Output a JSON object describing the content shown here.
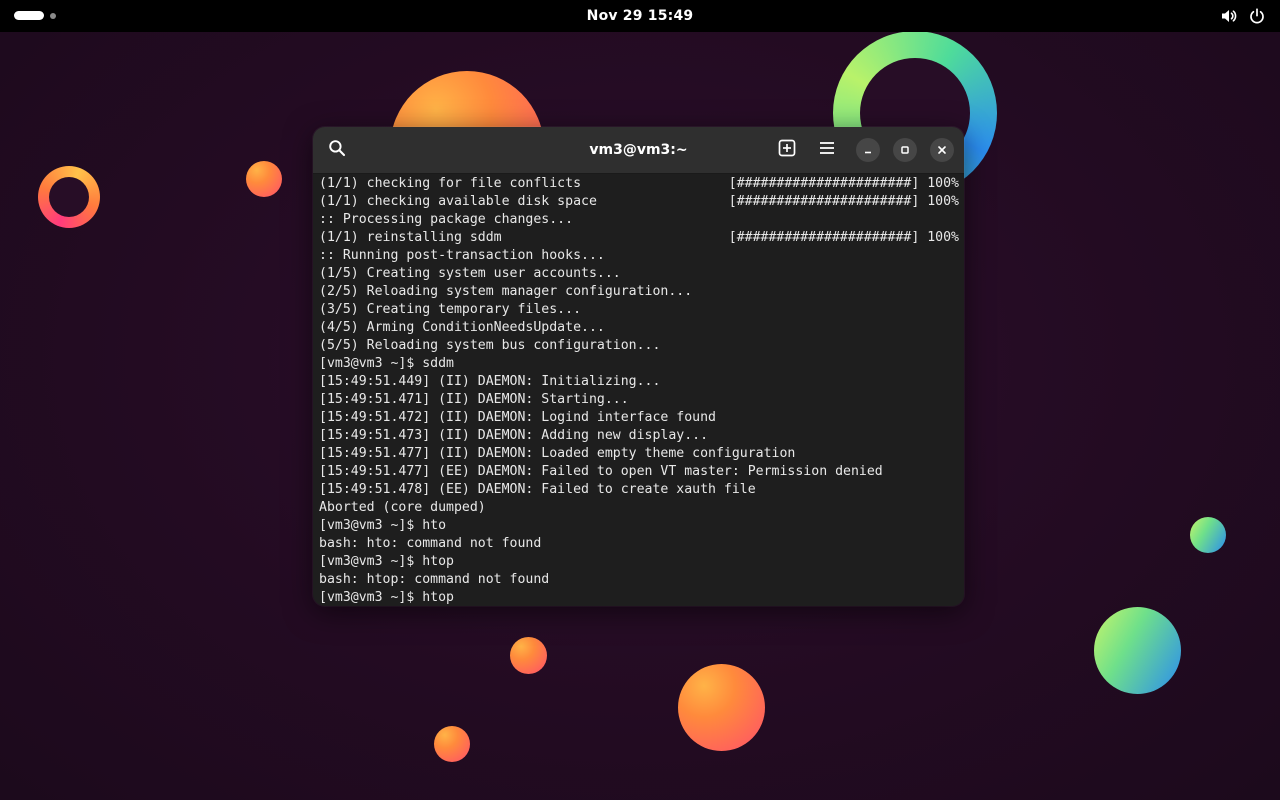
{
  "topbar": {
    "clock": "Nov 29  15:49",
    "icons": [
      "volume-icon",
      "power-icon"
    ]
  },
  "window": {
    "title": "vm3@vm3:~",
    "icons": [
      "search-icon",
      "new-tab-icon",
      "hamburger-menu-icon",
      "minimize-icon",
      "maximize-icon",
      "close-icon"
    ]
  },
  "terminal": {
    "lines": [
      {
        "text": "(1/1) checking for file conflicts",
        "progress": "[######################] 100%"
      },
      {
        "text": "(1/1) checking available disk space",
        "progress": "[######################] 100%"
      },
      {
        "text": ":: Processing package changes...",
        "progress": ""
      },
      {
        "text": "(1/1) reinstalling sddm",
        "progress": "[######################] 100%"
      },
      {
        "text": ":: Running post-transaction hooks...",
        "progress": ""
      },
      {
        "text": "(1/5) Creating system user accounts...",
        "progress": ""
      },
      {
        "text": "(2/5) Reloading system manager configuration...",
        "progress": ""
      },
      {
        "text": "(3/5) Creating temporary files...",
        "progress": ""
      },
      {
        "text": "(4/5) Arming ConditionNeedsUpdate...",
        "progress": ""
      },
      {
        "text": "(5/5) Reloading system bus configuration...",
        "progress": ""
      },
      {
        "text": "[vm3@vm3 ~]$ sddm",
        "progress": ""
      },
      {
        "text": "[15:49:51.449] (II) DAEMON: Initializing...",
        "progress": ""
      },
      {
        "text": "[15:49:51.471] (II) DAEMON: Starting...",
        "progress": ""
      },
      {
        "text": "[15:49:51.472] (II) DAEMON: Logind interface found",
        "progress": ""
      },
      {
        "text": "[15:49:51.473] (II) DAEMON: Adding new display...",
        "progress": ""
      },
      {
        "text": "[15:49:51.477] (II) DAEMON: Loaded empty theme configuration",
        "progress": ""
      },
      {
        "text": "[15:49:51.477] (EE) DAEMON: Failed to open VT master: Permission denied",
        "progress": ""
      },
      {
        "text": "[15:49:51.478] (EE) DAEMON: Failed to create xauth file",
        "progress": ""
      },
      {
        "text": "Aborted (core dumped)",
        "progress": ""
      },
      {
        "text": "[vm3@vm3 ~]$ hto",
        "progress": ""
      },
      {
        "text": "bash: hto: command not found",
        "progress": ""
      },
      {
        "text": "[vm3@vm3 ~]$ htop",
        "progress": ""
      },
      {
        "text": "bash: htop: command not found",
        "progress": ""
      },
      {
        "text": "[vm3@vm3 ~]$ htop",
        "progress": ""
      }
    ]
  },
  "colors": {
    "topbar": "#000000",
    "terminal_bg": "#1e1e1e",
    "headerbar_bg": "#2f2f2f",
    "text": "#e8e8e8"
  }
}
